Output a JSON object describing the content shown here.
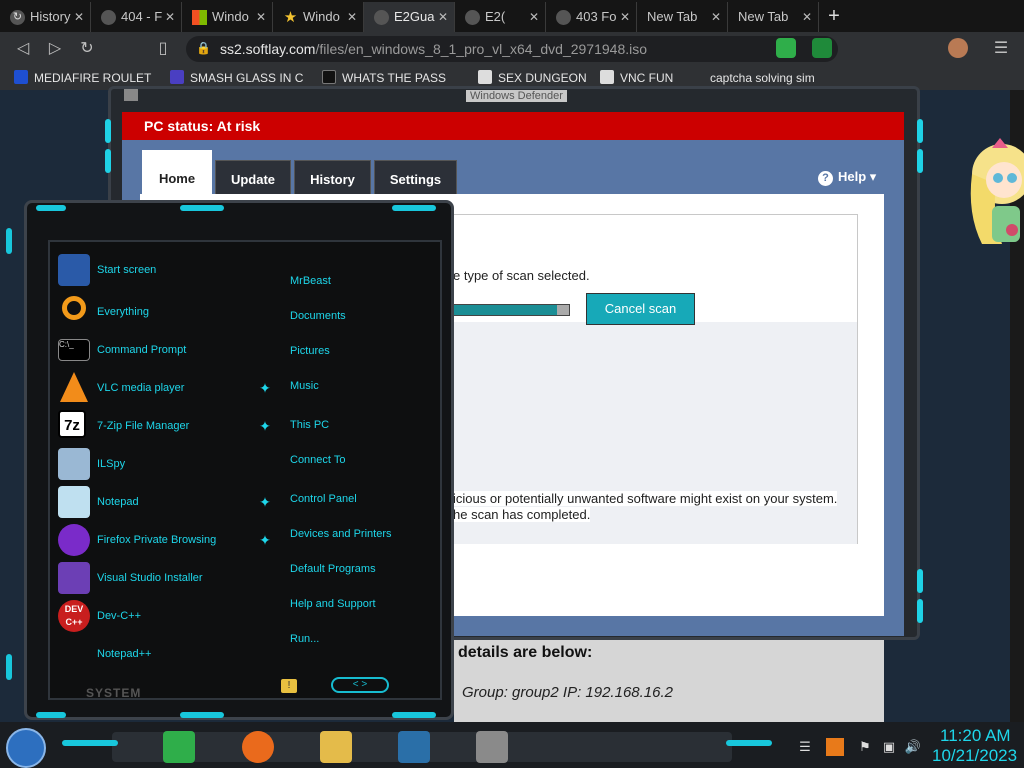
{
  "browser": {
    "tabs": [
      {
        "label": "History"
      },
      {
        "label": "404 - F"
      },
      {
        "label": "Windo"
      },
      {
        "label": "Windo"
      },
      {
        "label": "E2Gua"
      },
      {
        "label": "E2("
      },
      {
        "label": "403 Fo"
      },
      {
        "label": "New Tab"
      },
      {
        "label": "New Tab"
      }
    ],
    "url_host": "ss2.softlay.com",
    "url_path": "/files/en_windows_8_1_pro_vl_x64_dvd_2971948.iso",
    "bookmarks": [
      {
        "label": "MEDIAFIRE ROULET"
      },
      {
        "label": "SMASH GLASS IN C"
      },
      {
        "label": "WHATS THE PASS"
      },
      {
        "label": "SEX DUNGEON"
      },
      {
        "label": "VNC FUN"
      },
      {
        "label": "captcha solving sim"
      }
    ]
  },
  "defender": {
    "title": "Windows Defender",
    "status": "PC status: At risk",
    "tabs": [
      {
        "label": "Home"
      },
      {
        "label": "Update"
      },
      {
        "label": "History"
      },
      {
        "label": "Settings"
      }
    ],
    "help_label": "Help",
    "scan_text": "e type of scan selected.",
    "cancel_label": "Cancel scan",
    "warning_line1": "icious or potentially unwanted software might exist on your system.",
    "warning_line2": "he scan has completed."
  },
  "webpage": {
    "details_heading": "details are below:",
    "group_line": "Group: group2   IP: 192.168.16.2"
  },
  "start_menu": {
    "programs": [
      {
        "label": "Start screen"
      },
      {
        "label": "Everything"
      },
      {
        "label": "Command Prompt"
      },
      {
        "label": "VLC media player"
      },
      {
        "label": "7-Zip File Manager"
      },
      {
        "label": "ILSpy"
      },
      {
        "label": "Notepad"
      },
      {
        "label": "Firefox Private Browsing"
      },
      {
        "label": "Visual Studio Installer"
      },
      {
        "label": "Dev-C++"
      },
      {
        "label": "Notepad++"
      }
    ],
    "places": [
      {
        "label": "MrBeast"
      },
      {
        "label": "Documents"
      },
      {
        "label": "Pictures"
      },
      {
        "label": "Music"
      },
      {
        "label": "This PC"
      },
      {
        "label": "Connect To"
      },
      {
        "label": "Control Panel"
      },
      {
        "label": "Devices and Printers"
      },
      {
        "label": "Default Programs"
      },
      {
        "label": "Help and Support"
      },
      {
        "label": "Run..."
      }
    ],
    "system_label": "SYSTEM"
  },
  "taskbar": {
    "time": "11:20 AM",
    "date": "10/21/2023"
  },
  "colors": {
    "accent_cyan": "#1ed6ea",
    "status_red": "#cc0000",
    "defender_blue": "#5876a5"
  }
}
